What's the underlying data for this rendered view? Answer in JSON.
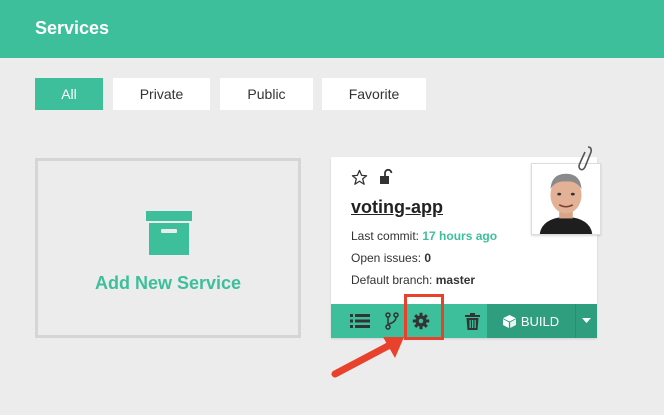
{
  "header": {
    "title": "Services"
  },
  "filters": [
    {
      "label": "All",
      "active": true
    },
    {
      "label": "Private",
      "active": false
    },
    {
      "label": "Public",
      "active": false
    },
    {
      "label": "Favorite",
      "active": false
    }
  ],
  "add_service": {
    "label": "Add New Service"
  },
  "service": {
    "name": "voting-app",
    "last_commit_label": "Last commit:",
    "last_commit_value": "17 hours ago",
    "open_issues_label": "Open issues:",
    "open_issues_value": "0",
    "default_branch_label": "Default branch:",
    "default_branch_value": "master",
    "build_label": "BUILD"
  },
  "colors": {
    "accent": "#3dbf9b",
    "accent_dark": "#2f9e7f",
    "highlight": "#e8412c"
  },
  "icons": {
    "star": "star-outline-icon",
    "lock": "unlocked-icon",
    "list": "list-icon",
    "branch": "git-branch-icon",
    "settings": "gear-icon",
    "delete": "trash-icon",
    "build": "cube-icon",
    "dropdown": "caret-down-icon",
    "pin": "paperclip-icon"
  }
}
